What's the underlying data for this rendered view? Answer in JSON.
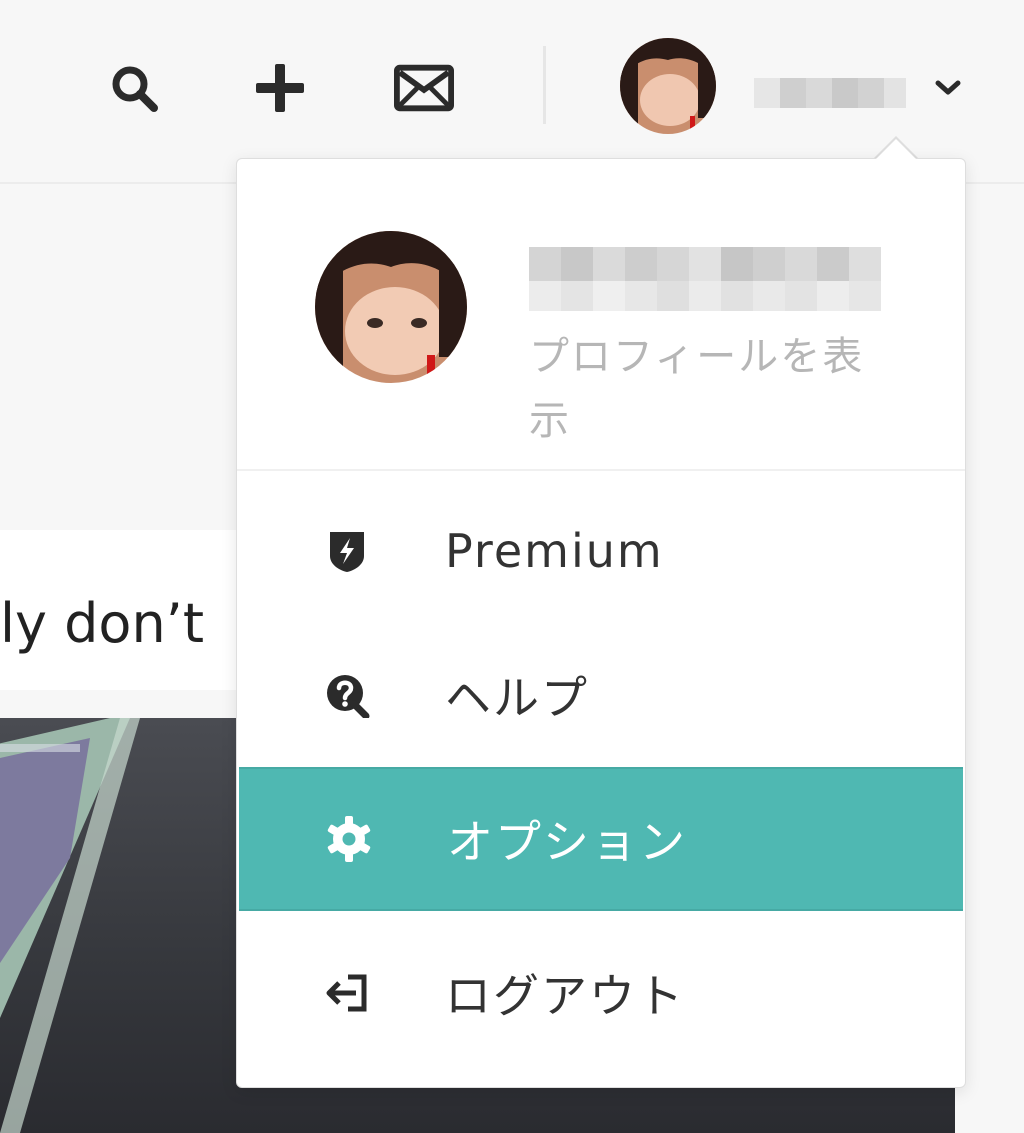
{
  "header": {
    "icons": [
      "search-icon",
      "plus-icon",
      "mail-icon",
      "chevron-down-icon"
    ]
  },
  "background": {
    "snippet": "ly don’t"
  },
  "menu": {
    "profile_link": "プロフィールを表示",
    "items": [
      {
        "label": "Premium",
        "icon": "premium-shield-icon"
      },
      {
        "label": "ヘルプ",
        "icon": "help-icon"
      },
      {
        "label": "オプション",
        "icon": "gear-icon"
      },
      {
        "label": "ログアウト",
        "icon": "logout-icon"
      }
    ]
  },
  "colors": {
    "accent": "#4fb8b2",
    "background": "#f7f7f7",
    "menu_text": "#333333",
    "muted_text": "#b6b6b6"
  }
}
